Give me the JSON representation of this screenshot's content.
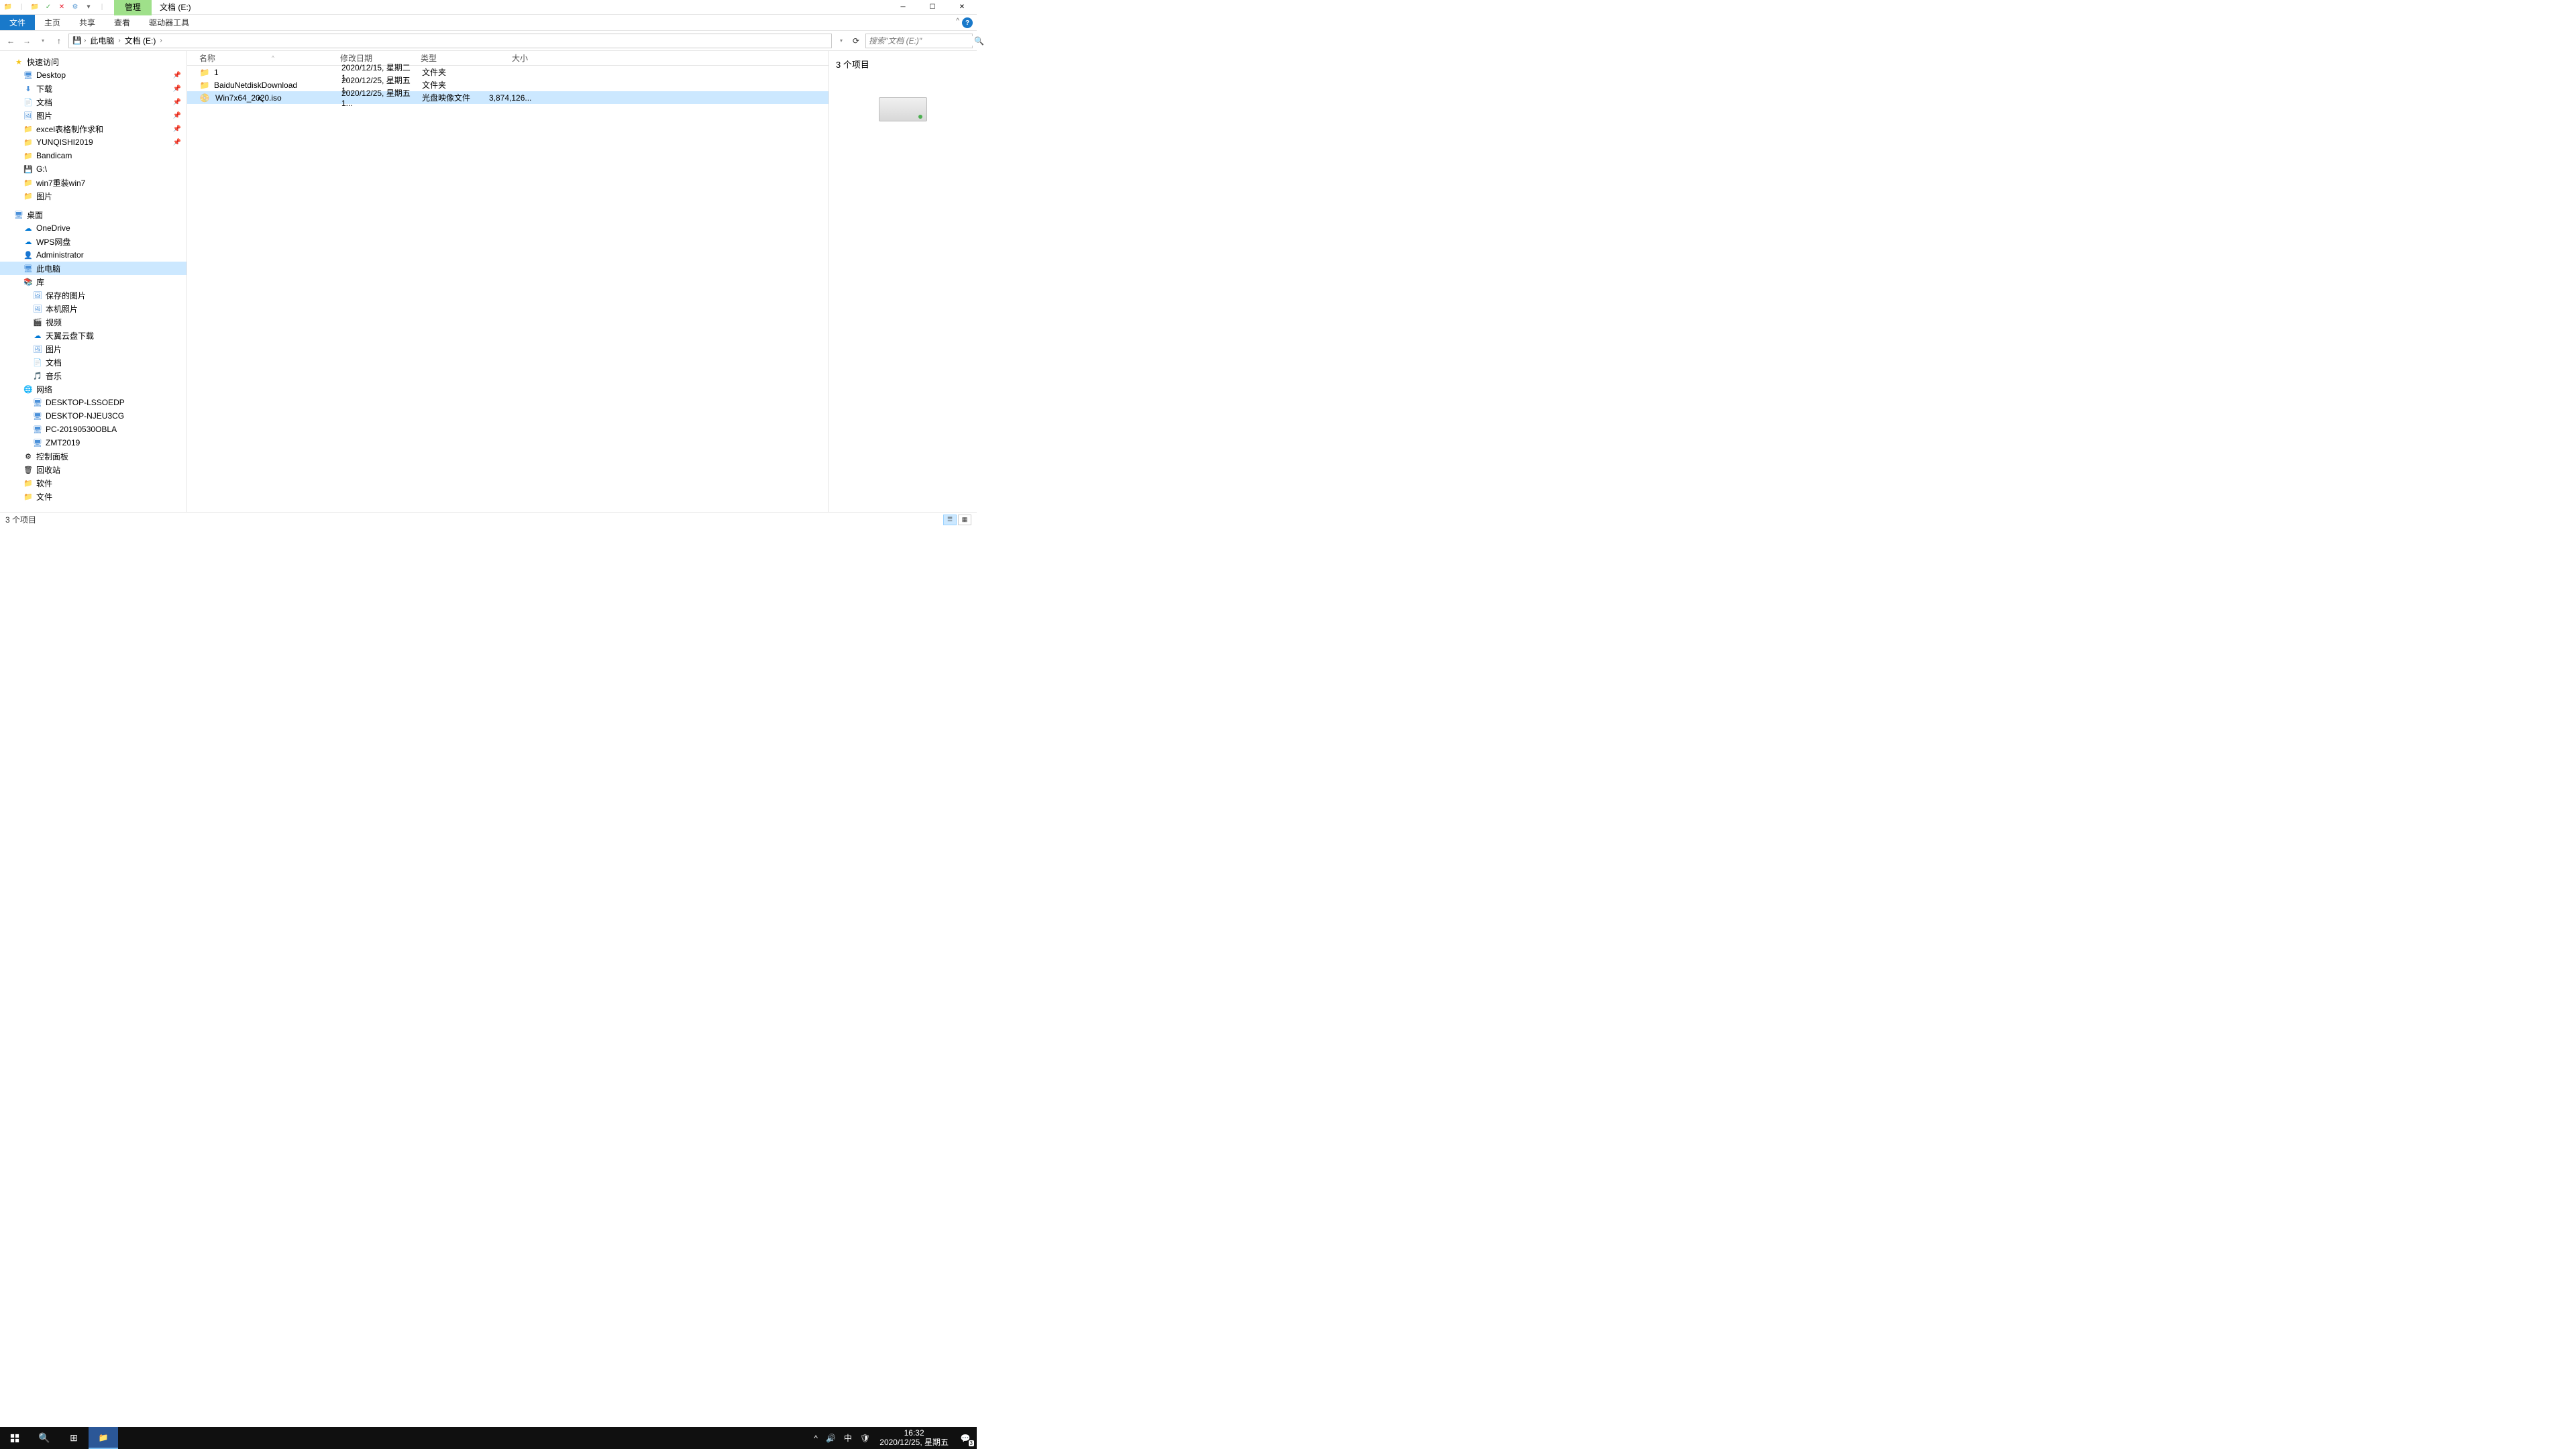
{
  "title": {
    "manage": "管理",
    "location": "文档 (E:)"
  },
  "ribbon": {
    "file": "文件",
    "home": "主页",
    "share": "共享",
    "view": "查看",
    "drive_tools": "驱动器工具"
  },
  "breadcrumb": {
    "this_pc": "此电脑",
    "drive": "文档 (E:)"
  },
  "search": {
    "placeholder": "搜索\"文档 (E:)\""
  },
  "columns": {
    "name": "名称",
    "date": "修改日期",
    "type": "类型",
    "size": "大小"
  },
  "files": [
    {
      "name": "1",
      "date": "2020/12/15, 星期二 1...",
      "type": "文件夹",
      "size": "",
      "icon": "folder"
    },
    {
      "name": "BaiduNetdiskDownload",
      "date": "2020/12/25, 星期五 1...",
      "type": "文件夹",
      "size": "",
      "icon": "folder"
    },
    {
      "name": "Win7x64_2020.iso",
      "date": "2020/12/25, 星期五 1...",
      "type": "光盘映像文件",
      "size": "3,874,126...",
      "icon": "iso",
      "selected": true
    }
  ],
  "nav": {
    "quick_access": "快速访问",
    "items_pinned": [
      {
        "label": "Desktop",
        "icon": "desktop"
      },
      {
        "label": "下载",
        "icon": "folder-blue"
      },
      {
        "label": "文档",
        "icon": "folder-blue"
      },
      {
        "label": "图片",
        "icon": "folder-blue"
      },
      {
        "label": "excel表格制作求和",
        "icon": "folder"
      },
      {
        "label": "YUNQISHI2019",
        "icon": "folder"
      }
    ],
    "items_recent": [
      {
        "label": "Bandicam",
        "icon": "folder"
      },
      {
        "label": "G:\\",
        "icon": "drive-g"
      },
      {
        "label": "win7重装win7",
        "icon": "folder"
      },
      {
        "label": "图片",
        "icon": "folder"
      }
    ],
    "desktop": "桌面",
    "desktop_items": [
      {
        "label": "OneDrive",
        "icon": "cloud"
      },
      {
        "label": "WPS网盘",
        "icon": "cloud-wps"
      },
      {
        "label": "Administrator",
        "icon": "user"
      },
      {
        "label": "此电脑",
        "icon": "pc",
        "selected": true
      },
      {
        "label": "库",
        "icon": "library"
      }
    ],
    "library_items": [
      {
        "label": "保存的图片",
        "icon": "pictures"
      },
      {
        "label": "本机照片",
        "icon": "pictures"
      },
      {
        "label": "视频",
        "icon": "video"
      },
      {
        "label": "天翼云盘下载",
        "icon": "cloud-ty"
      },
      {
        "label": "图片",
        "icon": "pictures"
      },
      {
        "label": "文档",
        "icon": "docs"
      },
      {
        "label": "音乐",
        "icon": "music"
      }
    ],
    "network": "网络",
    "network_items": [
      {
        "label": "DESKTOP-LSSOEDP",
        "icon": "pc-net"
      },
      {
        "label": "DESKTOP-NJEU3CG",
        "icon": "pc-net"
      },
      {
        "label": "PC-20190530OBLA",
        "icon": "pc-net"
      },
      {
        "label": "ZMT2019",
        "icon": "pc-net"
      }
    ],
    "bottom_items": [
      {
        "label": "控制面板",
        "icon": "control"
      },
      {
        "label": "回收站",
        "icon": "recycle"
      },
      {
        "label": "软件",
        "icon": "folder"
      },
      {
        "label": "文件",
        "icon": "folder"
      }
    ]
  },
  "preview": {
    "count_label": "3 个项目"
  },
  "status": {
    "text": "3 个项目"
  },
  "tray": {
    "ime": "中",
    "time": "16:32",
    "date": "2020/12/25, 星期五",
    "notif_count": "3"
  }
}
